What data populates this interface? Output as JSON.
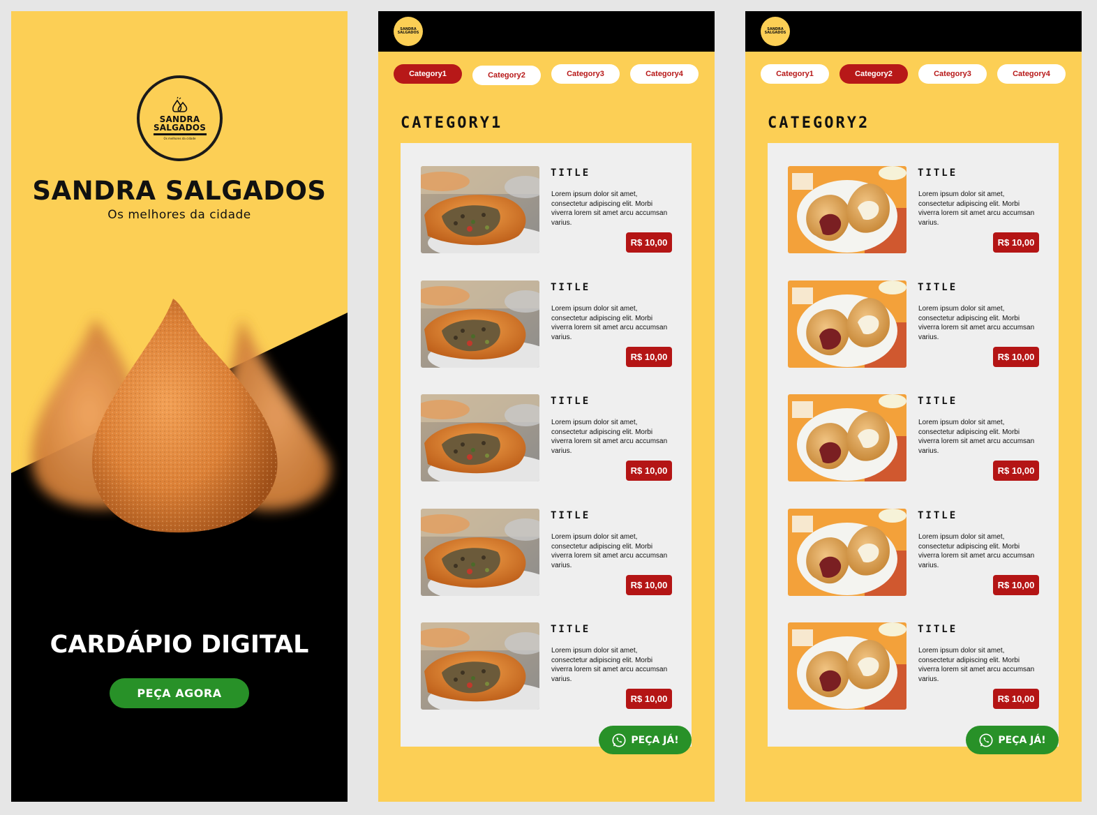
{
  "splash": {
    "logo_line1": "SANDRA",
    "logo_line2": "SALGADOS",
    "logo_tag": "Os melhores da cidade",
    "brand": "SANDRA SALGADOS",
    "tagline": "Os melhores da cidade",
    "heading": "CARDÁPIO DIGITAL",
    "cta_label": "PEÇA AGORA"
  },
  "colors": {
    "yellow": "#fccf55",
    "black": "#000000",
    "red": "#b41515",
    "green": "#289128",
    "panel": "#efefef"
  },
  "menu_screens": [
    {
      "mini_logo_line1": "SANDRA",
      "mini_logo_line2": "SALGADOS",
      "tabs": [
        "Category1",
        "Category2",
        "Category3",
        "Category4"
      ],
      "active_tab": "Category1",
      "section_title": "CATEGORY1",
      "image": "pastel-with-meat-filling",
      "items": [
        {
          "title": "TITLE",
          "desc": "Lorem ipsum dolor sit amet, consectetur adipiscing elit.  Morbi viverra lorem sit amet  arcu accumsan varius.",
          "price": "R$ 10,00"
        },
        {
          "title": "TITLE",
          "desc": "Lorem ipsum dolor sit amet, consectetur adipiscing elit.  Morbi viverra lorem sit amet  arcu accumsan varius.",
          "price": "R$ 10,00"
        },
        {
          "title": "TITLE",
          "desc": "Lorem ipsum dolor sit amet, consectetur adipiscing elit.  Morbi viverra lorem sit amet  arcu accumsan varius.",
          "price": "R$ 10,00"
        },
        {
          "title": "TITLE",
          "desc": "Lorem ipsum dolor sit amet, consectetur adipiscing elit.  Morbi viverra lorem sit amet  arcu accumsan varius.",
          "price": "R$ 10,00"
        },
        {
          "title": "TITLE",
          "desc": "Lorem ipsum dolor sit amet, consectetur adipiscing elit.  Morbi viverra lorem sit amet  arcu accumsan varius.",
          "price": "R$ 10,00"
        }
      ],
      "whatsapp_label": "PEÇA JÁ!"
    },
    {
      "mini_logo_line1": "SANDRA",
      "mini_logo_line2": "SALGADOS",
      "tabs": [
        "Category1",
        "Category2",
        "Category3",
        "Category4"
      ],
      "active_tab": "Category2",
      "section_title": "CATEGORY2",
      "image": "coxinha-on-plate",
      "items": [
        {
          "title": "TITLE",
          "desc": "Lorem ipsum dolor sit amet, consectetur adipiscing elit.  Morbi viverra lorem sit amet  arcu accumsan varius.",
          "price": "R$ 10,00"
        },
        {
          "title": "TITLE",
          "desc": "Lorem ipsum dolor sit amet, consectetur adipiscing elit.  Morbi viverra lorem sit amet  arcu accumsan varius.",
          "price": "R$ 10,00"
        },
        {
          "title": "TITLE",
          "desc": "Lorem ipsum dolor sit amet, consectetur adipiscing elit.  Morbi viverra lorem sit amet  arcu accumsan varius.",
          "price": "R$ 10,00"
        },
        {
          "title": "TITLE",
          "desc": "Lorem ipsum dolor sit amet, consectetur adipiscing elit.  Morbi viverra lorem sit amet  arcu accumsan varius.",
          "price": "R$ 10,00"
        },
        {
          "title": "TITLE",
          "desc": "Lorem ipsum dolor sit amet, consectetur adipiscing elit.  Morbi viverra lorem sit amet  arcu accumsan varius.",
          "price": "R$ 10,00"
        }
      ],
      "whatsapp_label": "PEÇA JÁ!"
    }
  ]
}
